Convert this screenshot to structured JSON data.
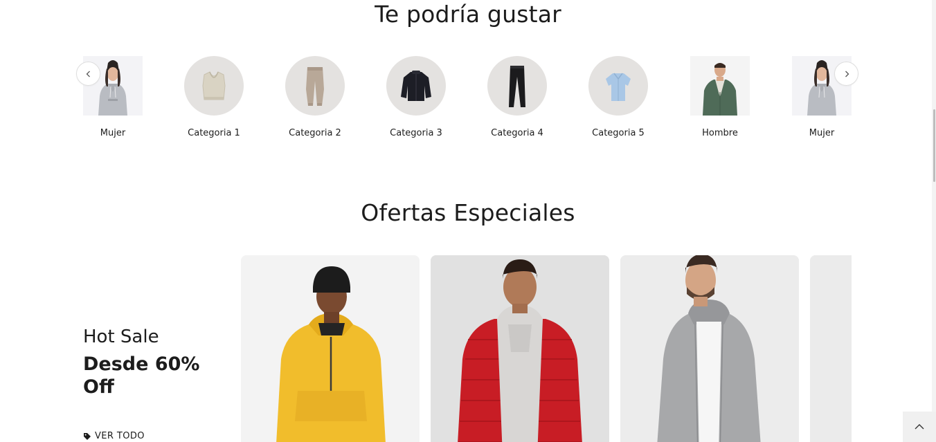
{
  "sections": {
    "recommended_title": "Te podría gustar",
    "offers_title": "Ofertas Especiales"
  },
  "categories": [
    {
      "label": "Mujer",
      "icon": "woman-hoodie-photo"
    },
    {
      "label": "Categoria 1",
      "icon": "vest-icon"
    },
    {
      "label": "Categoria 2",
      "icon": "pants-icon"
    },
    {
      "label": "Categoria 3",
      "icon": "jacket-icon"
    },
    {
      "label": "Categoria 4",
      "icon": "trousers-icon"
    },
    {
      "label": "Categoria 5",
      "icon": "shirt-icon"
    },
    {
      "label": "Hombre",
      "icon": "man-cardigan-photo"
    },
    {
      "label": "Mujer",
      "icon": "woman-hoodie-photo"
    }
  ],
  "carousel": {
    "prev_icon": "chevron-left-icon",
    "next_icon": "chevron-right-icon"
  },
  "promo": {
    "kicker": "Hot Sale",
    "headline": "Desde 60% Off",
    "link_label": "VER TODO",
    "link_icon": "tag-icon"
  },
  "products": [
    {
      "icon": "yellow-anorak-photo"
    },
    {
      "icon": "red-puffer-jacket-photo"
    },
    {
      "icon": "grey-zip-hoodie-photo"
    },
    {
      "icon": "product-photo"
    }
  ],
  "back_to_top": {
    "icon": "chevron-up-icon"
  },
  "colors": {
    "text": "#1c1c1c",
    "thumb_bg": "#e4e2e0",
    "card_bg": "#f3f3f3",
    "accent_yellow": "#f1bd2c",
    "accent_red": "#c81d25"
  }
}
